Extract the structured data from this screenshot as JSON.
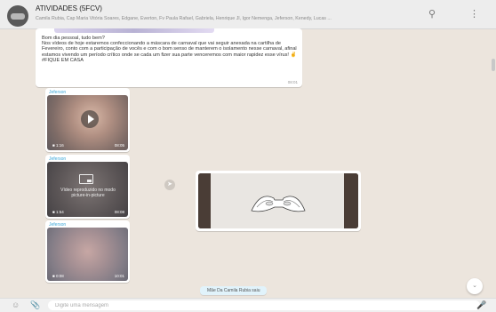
{
  "header": {
    "title": "ATIVIDADES (5FCV)",
    "members": "Camila Rubia, Cap Maria Vitória Soares, Edgane, Everton, Fv Paula Rafael, Gabriela, Henrique Jl, Igor Nemenga, Jeferson, Kenedy, Lucas ...",
    "icons": [
      "search-icon",
      "menu-icon"
    ]
  },
  "text_message": {
    "body": "Bom dia pessoal, tudo bem?\nNos vídeos de hoje estaremos confeccionando a máscara de carnaval que vai seguir anexada na cartilha de Fevereiro, conto com a participação de vocês e com o bom senso de manterem o isolamento nesse carnaval, afinal estamos vivendo um período crítico onde se cada um fizer sua parte venceremos com maior rapidez esse vírus! ✌\n#FIQUE EM CASA",
    "time": "08:01"
  },
  "videos": [
    {
      "sender": "Jeferson",
      "duration": "1:16",
      "time": "08:05"
    },
    {
      "sender": "Jeferson",
      "duration": "1:54",
      "time": "08:08",
      "pip_text": "Vídeo reproduzido no modo picture-in-picture"
    },
    {
      "sender": "Jeferson",
      "duration": "0:08",
      "time": "10:01"
    }
  ],
  "notice": "Mãe Da Camila Rubia saiu",
  "composer": {
    "placeholder": "Digite uma mensagem"
  },
  "colors": {
    "sender": "#3aa6d8",
    "header_bg": "#ededed",
    "chat_bg": "#ece5dd"
  }
}
